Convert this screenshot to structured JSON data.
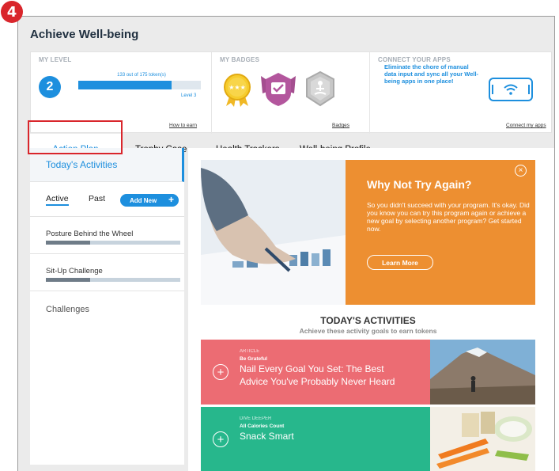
{
  "step_number": "4",
  "page_title": "Achieve Well-being",
  "summary": {
    "level": {
      "heading": "MY LEVEL",
      "current": "2",
      "tokens_text": "133 out of 175 token(s)",
      "progress": 0.76,
      "next_level": "Level 3",
      "link": "How to earn"
    },
    "badges": {
      "heading": "MY BADGES",
      "link": "Badges"
    },
    "apps": {
      "heading": "CONNECT YOUR APPS",
      "text": "Eliminate the chore of manual data input and sync all your Well-being apps in one place!",
      "link": "Connect my apps"
    }
  },
  "tabs": [
    {
      "label": "Action Plan",
      "active": true
    },
    {
      "label": "Trophy Case"
    },
    {
      "label": "Health Trackers"
    },
    {
      "label": "Well-being Profile"
    }
  ],
  "left": {
    "today": "Today's Activities",
    "sub_tabs": [
      "Active",
      "Past"
    ],
    "add_new": "Add New",
    "activities": [
      {
        "name": "Posture Behind the Wheel",
        "progress": 0.33
      },
      {
        "name": "Sit-Up Challenge",
        "progress": 0.33
      }
    ],
    "challenges": "Challenges"
  },
  "promo": {
    "title": "Why Not Try Again?",
    "body": "So you didn't succeed with your program. It's okay. Did you know you can try this program again or achieve a new goal by selecting another program? Get started now.",
    "button": "Learn More",
    "close": "×"
  },
  "activities_section": {
    "title": "TODAY'S ACTIVITIES",
    "subtitle": "Achieve these activity goals to earn tokens"
  },
  "cards": [
    {
      "category": "ARTICLE",
      "tag": "Be Grateful",
      "title": "Nail Every Goal You Set: The Best Advice You've Probably Never Heard",
      "color": "#ec6c73"
    },
    {
      "category": "DIVE DEEPER",
      "tag": "All Calories Count",
      "title": "Snack Smart",
      "color": "#27b78c"
    }
  ],
  "colors": {
    "accent": "#1d8fde",
    "promo": "#ed8f31",
    "highlight": "#d9262c"
  }
}
